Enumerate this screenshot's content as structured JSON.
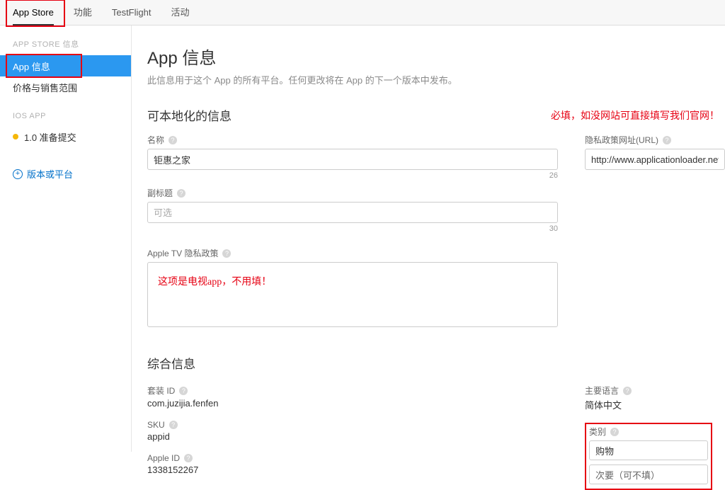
{
  "topTabs": {
    "items": [
      "App Store",
      "功能",
      "TestFlight",
      "活动"
    ],
    "activeIndex": 0
  },
  "sidebar": {
    "section1": {
      "header": "APP STORE 信息",
      "items": [
        "App 信息",
        "价格与销售范围"
      ],
      "activeIndex": 0
    },
    "section2": {
      "header": "IOS APP",
      "item": "1.0 准备提交"
    },
    "addLink": "版本或平台"
  },
  "page": {
    "title": "App 信息",
    "desc": "此信息用于这个 App 的所有平台。任何更改将在 App 的下一个版本中发布。"
  },
  "localizable": {
    "title": "可本地化的信息",
    "annotation": "必填，如没网站可直接填写我们官网！",
    "nameLabel": "名称",
    "nameValue": "钜惠之家",
    "nameCount": "26",
    "subtitleLabel": "副标题",
    "subtitlePlaceholder": "可选",
    "subtitleCount": "30",
    "privacyUrlLabel": "隐私政策网址(URL)",
    "privacyUrlValue": "http://www.applicationloader.net/",
    "tvLabel": "Apple TV 隐私政策",
    "tvNote": "这项是电视app，不用填！"
  },
  "general": {
    "title": "综合信息",
    "bundleIdLabel": "套装 ID",
    "bundleIdValue": "com.juzijia.fenfen",
    "skuLabel": "SKU",
    "skuValue": "appid",
    "appleIdLabel": "Apple ID",
    "appleIdValue": "1338152267",
    "primaryLangLabel": "主要语言",
    "primaryLangValue": "简体中文",
    "categoryLabel": "类别",
    "categoryPrimary": "购物",
    "categorySecondary": "次要（可不填）"
  },
  "helpGlyph": "?"
}
